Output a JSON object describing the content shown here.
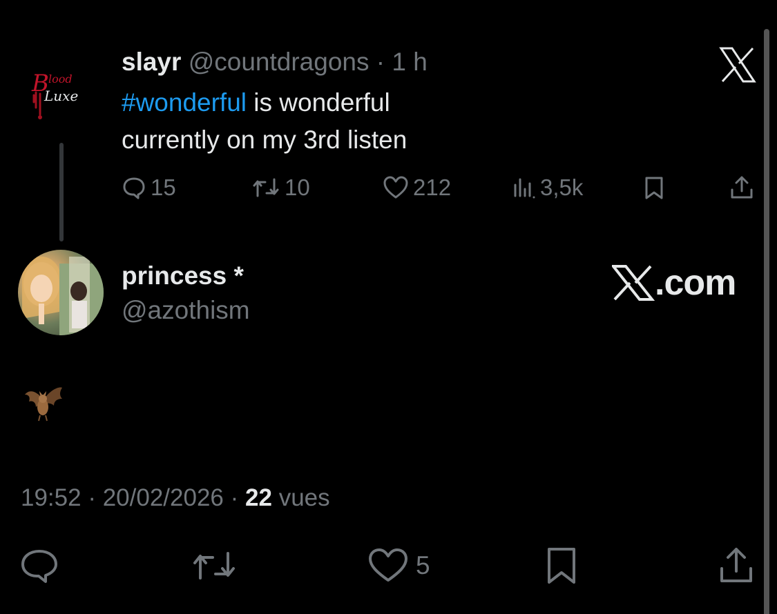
{
  "parent_tweet": {
    "display_name": "slayr",
    "handle": "@countdragons",
    "separator": "·",
    "time_ago": "1 h",
    "avatar_icon": "blood-luxe-logo-icon",
    "text_hashtag": "#wonderful",
    "text_line1_rest": " is wonderful",
    "text_line2": "currently on my 3rd listen",
    "metrics": {
      "replies": "15",
      "reposts": "10",
      "likes": "212",
      "views": "3,5k"
    }
  },
  "reply_tweet": {
    "display_name": "princess *",
    "handle": "@azothism",
    "avatar_icon": "profile-photo-avatar",
    "content_emoji_icon": "bat-emoji-icon",
    "timestamp_time": "19:52",
    "timestamp_date": "20/02/2026",
    "separator": "·",
    "views_count": "22",
    "views_label": "vues",
    "likes": "5"
  },
  "branding": {
    "small_logo_icon": "x-logo-icon",
    "site_text": ".com"
  },
  "colors": {
    "background": "#000000",
    "text_primary": "#e7e9ea",
    "text_muted": "#71767b",
    "link": "#1d9bf0"
  }
}
